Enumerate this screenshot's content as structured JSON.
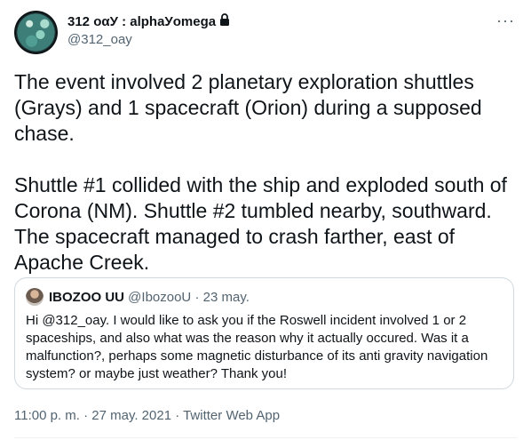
{
  "user": {
    "display_name": "312 οαУ : alphaУomega",
    "handle": "@312_oay"
  },
  "more_label": "···",
  "tweet_text": "The event involved 2 planetary exploration shuttles (Grays) and 1 spacecraft (Orion) during a supposed chase.\n\nShuttle #1 collided with the ship and exploded south of Corona (NM). Shuttle #2 tumbled nearby, southward. The spacecraft managed to crash farther, east of Apache Creek.",
  "quoted": {
    "name": "IBOZOO UU",
    "handle": "@IbozooU",
    "separator": "·",
    "date": "23 may.",
    "text": "Hi @312_oay. I would like to ask you if the Roswell incident involved 1 or 2 spaceships, and also what was the reason why it actually occured. Was it a malfunction?, perhaps some magnetic disturbance of its anti gravity navigation system? or maybe just weather? Thank you!"
  },
  "footer": "11:00 p. m. · 27 may. 2021 · Twitter Web App",
  "icons": {
    "lock": "lock-icon",
    "more": "more-icon"
  }
}
